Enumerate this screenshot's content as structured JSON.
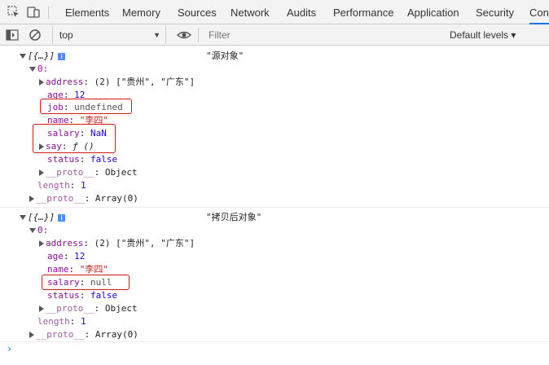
{
  "tabs": [
    "Elements",
    "Memory",
    "Sources",
    "Network",
    "Audits",
    "Performance",
    "Application",
    "Security",
    "Cons"
  ],
  "toolbar": {
    "context": "top",
    "filter_placeholder": "Filter",
    "levels": "Default levels ▾"
  },
  "colors": {
    "accent": "#1a73e8",
    "highlight_box": "#d11a1a"
  },
  "log1": {
    "header": "[{…}]",
    "label": "\"源对象\"",
    "index": "0:",
    "address_key": "address",
    "address_val": "(2) [\"贵州\", \"广东\"]",
    "age_key": "age",
    "age_val": "12",
    "job_key": "job",
    "job_val": "undefined",
    "name_key": "name",
    "name_val": "\"李四\"",
    "salary_key": "salary",
    "salary_val": "NaN",
    "say_key": "say",
    "say_val": "ƒ ()",
    "status_key": "status",
    "status_val": "false",
    "proto_key": "__proto__",
    "proto_val": "Object",
    "length_key": "length",
    "length_val": "1",
    "arr_proto_key": "__proto__",
    "arr_proto_val": "Array(0)"
  },
  "log2": {
    "header": "[{…}]",
    "label": "\"拷贝后对象\"",
    "index": "0:",
    "address_key": "address",
    "address_val": "(2) [\"贵州\", \"广东\"]",
    "age_key": "age",
    "age_val": "12",
    "name_key": "name",
    "name_val": "\"李四\"",
    "salary_key": "salary",
    "salary_val": "null",
    "status_key": "status",
    "status_val": "false",
    "proto_key": "__proto__",
    "proto_val": "Object",
    "length_key": "length",
    "length_val": "1",
    "arr_proto_key": "__proto__",
    "arr_proto_val": "Array(0)"
  },
  "prompt": "›"
}
